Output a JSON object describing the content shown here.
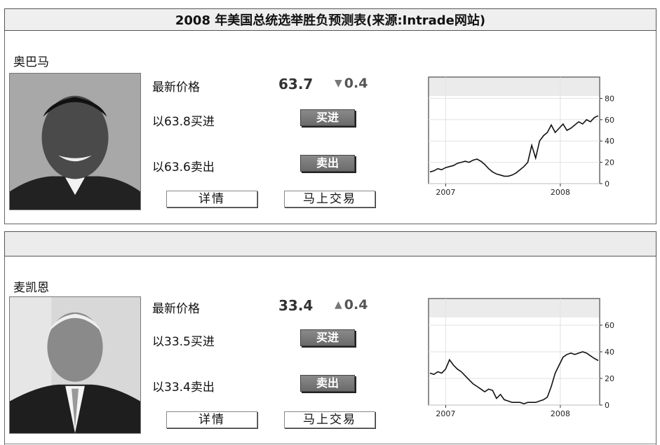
{
  "title": "2008 年美国总统选举胜负预测表(来源:Intrade网站)",
  "labels": {
    "latest_price": "最新价格",
    "details": "详情",
    "trade_now": "马上交易",
    "buy": "买进",
    "sell": "卖出"
  },
  "candidates": [
    {
      "name": "奥巴马",
      "price": "63.7",
      "change": "0.4",
      "change_direction": "down",
      "buy_text": "以63.8买进",
      "sell_text": "以63.6卖出",
      "chart_data": {
        "type": "line",
        "x_tick_labels": [
          "2007",
          "2008"
        ],
        "y_ticks": [
          0,
          20,
          40,
          60,
          80
        ],
        "ylim": [
          0,
          100
        ],
        "series": [
          {
            "values": [
              11,
              12,
              14,
              13,
              15,
              16,
              17,
              19,
              20,
              21,
              20,
              22,
              23,
              21,
              18,
              14,
              11,
              9,
              8,
              7,
              7,
              8,
              10,
              13,
              16,
              20,
              36,
              24,
              40,
              45,
              48,
              55,
              48,
              52,
              56,
              50,
              52,
              55,
              58,
              56,
              60,
              58,
              62,
              63.7
            ]
          }
        ]
      }
    },
    {
      "name": "麦凯恩",
      "price": "33.4",
      "change": "0.4",
      "change_direction": "up",
      "buy_text": "以33.5买进",
      "sell_text": "以33.4卖出",
      "chart_data": {
        "type": "line",
        "x_tick_labels": [
          "2007",
          "2008"
        ],
        "y_ticks": [
          0,
          20,
          40,
          60
        ],
        "ylim": [
          0,
          80
        ],
        "series": [
          {
            "values": [
              24,
              23,
              25,
              24,
              27,
              34,
              30,
              27,
              25,
              22,
              19,
              16,
              14,
              12,
              10,
              12,
              11,
              5,
              8,
              4,
              3,
              2,
              2,
              2,
              1,
              2,
              2,
              2,
              3,
              4,
              6,
              14,
              24,
              30,
              36,
              38,
              39,
              38,
              39,
              40,
              39,
              37,
              35,
              33.4
            ]
          }
        ]
      }
    }
  ]
}
